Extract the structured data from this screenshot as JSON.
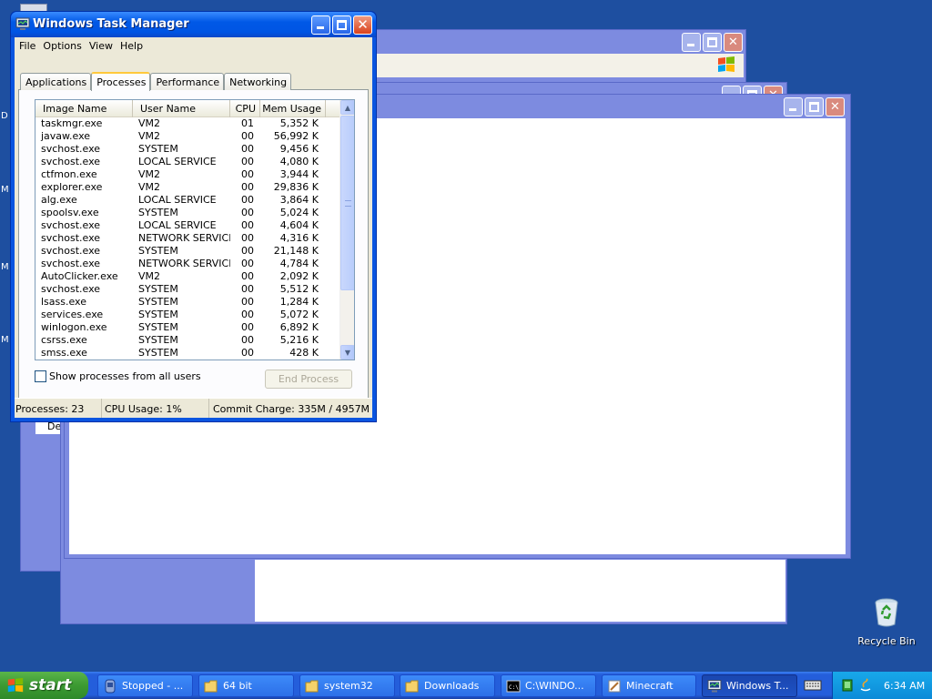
{
  "desktop": {
    "side_letters": [
      "D",
      "M",
      "M",
      "M"
    ],
    "recycle_bin": {
      "label": "Recycle Bin"
    }
  },
  "background_windows": {
    "partial_label": "De"
  },
  "task_manager": {
    "title": "Windows Task Manager",
    "menu": [
      "File",
      "Options",
      "View",
      "Help"
    ],
    "tabs": [
      {
        "label": "Applications",
        "active": false
      },
      {
        "label": "Processes",
        "active": true
      },
      {
        "label": "Performance",
        "active": false
      },
      {
        "label": "Networking",
        "active": false
      }
    ],
    "columns": {
      "image_name": "Image Name",
      "user_name": "User Name",
      "cpu": "CPU",
      "mem_usage": "Mem Usage"
    },
    "processes": [
      {
        "image": "taskmgr.exe",
        "user": "VM2",
        "cpu": "01",
        "mem": "5,352 K"
      },
      {
        "image": "javaw.exe",
        "user": "VM2",
        "cpu": "00",
        "mem": "56,992 K"
      },
      {
        "image": "svchost.exe",
        "user": "SYSTEM",
        "cpu": "00",
        "mem": "9,456 K"
      },
      {
        "image": "svchost.exe",
        "user": "LOCAL SERVICE",
        "cpu": "00",
        "mem": "4,080 K"
      },
      {
        "image": "ctfmon.exe",
        "user": "VM2",
        "cpu": "00",
        "mem": "3,944 K"
      },
      {
        "image": "explorer.exe",
        "user": "VM2",
        "cpu": "00",
        "mem": "29,836 K"
      },
      {
        "image": "alg.exe",
        "user": "LOCAL SERVICE",
        "cpu": "00",
        "mem": "3,864 K"
      },
      {
        "image": "spoolsv.exe",
        "user": "SYSTEM",
        "cpu": "00",
        "mem": "5,024 K"
      },
      {
        "image": "svchost.exe",
        "user": "LOCAL SERVICE",
        "cpu": "00",
        "mem": "4,604 K"
      },
      {
        "image": "svchost.exe",
        "user": "NETWORK SERVICE",
        "cpu": "00",
        "mem": "4,316 K"
      },
      {
        "image": "svchost.exe",
        "user": "SYSTEM",
        "cpu": "00",
        "mem": "21,148 K"
      },
      {
        "image": "svchost.exe",
        "user": "NETWORK SERVICE",
        "cpu": "00",
        "mem": "4,784 K"
      },
      {
        "image": "AutoClicker.exe",
        "user": "VM2",
        "cpu": "00",
        "mem": "2,092 K"
      },
      {
        "image": "svchost.exe",
        "user": "SYSTEM",
        "cpu": "00",
        "mem": "5,512 K"
      },
      {
        "image": "lsass.exe",
        "user": "SYSTEM",
        "cpu": "00",
        "mem": "1,284 K"
      },
      {
        "image": "services.exe",
        "user": "SYSTEM",
        "cpu": "00",
        "mem": "5,072 K"
      },
      {
        "image": "winlogon.exe",
        "user": "SYSTEM",
        "cpu": "00",
        "mem": "6,892 K"
      },
      {
        "image": "csrss.exe",
        "user": "SYSTEM",
        "cpu": "00",
        "mem": "5,216 K"
      },
      {
        "image": "smss.exe",
        "user": "SYSTEM",
        "cpu": "00",
        "mem": "428 K"
      }
    ],
    "show_all_users": {
      "label": "Show processes from all users",
      "checked": false
    },
    "end_process_label": "End Process",
    "status": {
      "processes": "Processes: 23",
      "cpu_usage": "CPU Usage: 1%",
      "commit_charge": "Commit Charge: 335M / 4957M"
    }
  },
  "taskbar": {
    "start_label": "start",
    "tasks": [
      {
        "label": "Stopped - ...",
        "icon": "app-icon",
        "active": false
      },
      {
        "label": "64 bit",
        "icon": "folder-icon",
        "active": false
      },
      {
        "label": "system32",
        "icon": "folder-icon",
        "active": false
      },
      {
        "label": "Downloads",
        "icon": "folder-icon",
        "active": false
      },
      {
        "label": "C:\\WINDO...",
        "icon": "console-icon",
        "active": false
      },
      {
        "label": "Minecraft",
        "icon": "minecraft-icon",
        "active": false
      },
      {
        "label": "Windows T...",
        "icon": "taskmgr-icon",
        "active": true
      }
    ],
    "clock": "6:34 AM"
  },
  "colors": {
    "desktop": "#1e4fa0",
    "titlebar": "#0058e6",
    "window_body": "#ece9d8",
    "taskbar": "#245edb",
    "start_button": "#3c9a32",
    "tray": "#0c8bd8"
  }
}
